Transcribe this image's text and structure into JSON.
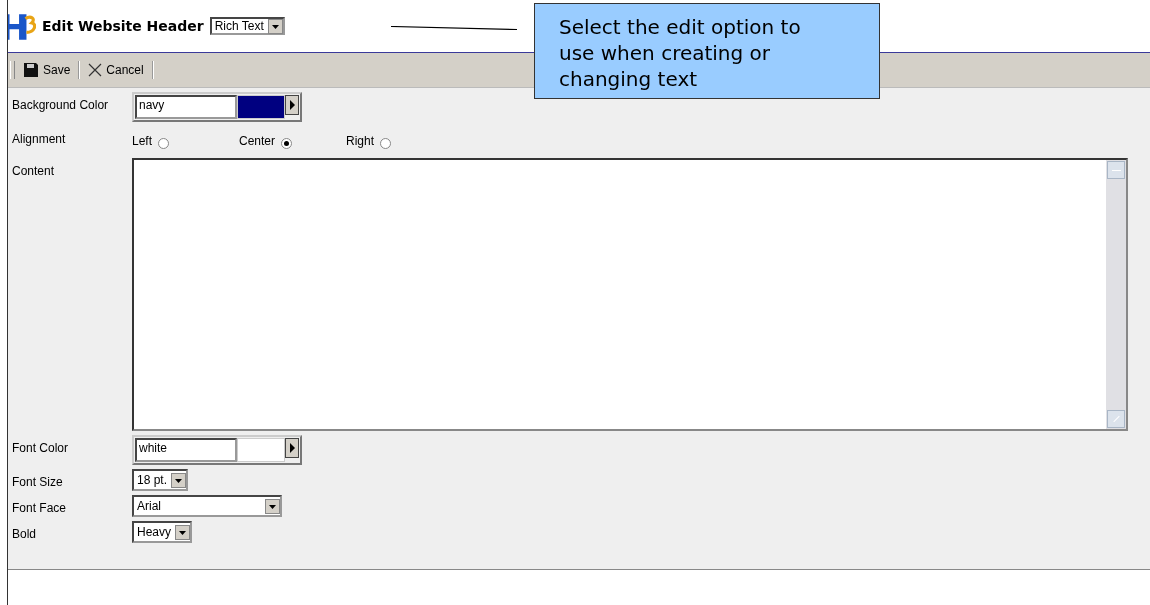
{
  "header": {
    "title": "Edit Website Header",
    "editor_select": "Rich Text"
  },
  "toolbar": [
    {
      "kind": "save",
      "label": "Save"
    },
    {
      "kind": "cancel",
      "label": "Cancel"
    }
  ],
  "fields": [
    {
      "kind": "color",
      "label": "Background Color",
      "value": "navy",
      "color": "#000080"
    },
    {
      "kind": "radio",
      "label": "Alignment",
      "options": [
        {
          "label": "Left",
          "selected": false
        },
        {
          "label": "Center",
          "selected": true
        },
        {
          "label": "Right",
          "selected": false
        }
      ]
    },
    {
      "kind": "textarea",
      "label": "Content"
    },
    {
      "kind": "color",
      "label": "Font Color",
      "value": "white",
      "color": "#ffffff"
    },
    {
      "kind": "select",
      "label": "Font Size",
      "value": "18 pt.",
      "wide": false
    },
    {
      "kind": "select",
      "label": "Font Face",
      "value": "Arial",
      "wide": true
    },
    {
      "kind": "select",
      "label": "Bold",
      "value": "Heavy",
      "wide": false
    }
  ],
  "callout": {
    "text": "Select the edit option to use when creating or changing text"
  }
}
